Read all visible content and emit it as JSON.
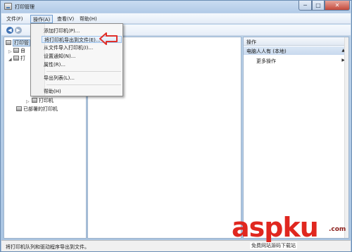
{
  "window": {
    "title": "打印管理",
    "controls": {
      "minimize": "─",
      "maximize": "□",
      "close": "✕"
    }
  },
  "menubar": {
    "items": [
      "文件(F)",
      "操作(A)",
      "查看(V)",
      "帮助(H)"
    ],
    "active_index": 1
  },
  "toolbar": {
    "back_icon": "arrow-left-icon",
    "forward_icon": "arrow-right-icon"
  },
  "dropdown": {
    "items": [
      {
        "label": "添加打印机(P)..."
      },
      {
        "label": "将打印机导出到文件(E)..."
      },
      {
        "label": "从文件导入打印机(I)..."
      },
      {
        "label": "设置通知(N)..."
      },
      {
        "label": "属性(R)..."
      },
      {
        "label": "导出列表(L)..."
      },
      {
        "label": "帮助(H)"
      }
    ],
    "highlighted_index": 1
  },
  "tree": {
    "items": [
      {
        "label": "打印管",
        "toggle": ""
      },
      {
        "label": "自",
        "toggle": "▷"
      },
      {
        "label": "打",
        "toggle": "◢"
      },
      {
        "label": "打印机",
        "toggle": "▷"
      },
      {
        "label": "已部署的打印机",
        "toggle": ""
      }
    ]
  },
  "actions_panel": {
    "header": "操作",
    "section": "电脑人人有 (本地)",
    "action": "更多操作"
  },
  "statusbar": {
    "text": "将打印机队列和驱动程序导出到文件。"
  },
  "watermark": {
    "big": "aspku",
    "com": ".com",
    "small": "免费网站源码下载站"
  },
  "colors": {
    "accent_arrow": "#e0302a",
    "selection": "#cfe3f7"
  }
}
